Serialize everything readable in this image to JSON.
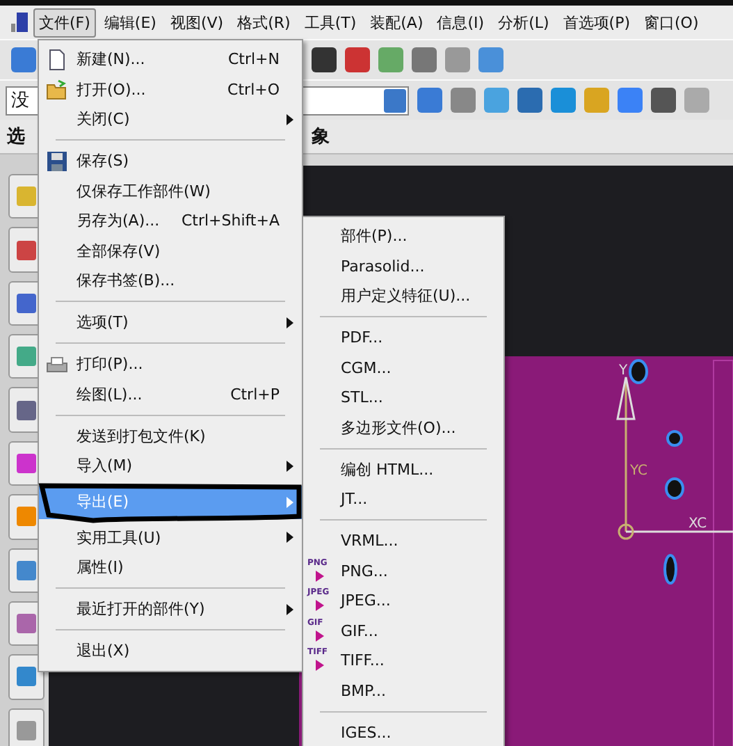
{
  "menubar": [
    {
      "label": "文件(F)",
      "selected": true
    },
    {
      "label": "编辑(E)",
      "selected": false
    },
    {
      "label": "视图(V)",
      "selected": false
    },
    {
      "label": "格式(R)",
      "selected": false
    },
    {
      "label": "工具(T)",
      "selected": false
    },
    {
      "label": "装配(A)",
      "selected": false
    },
    {
      "label": "信息(I)",
      "selected": false
    },
    {
      "label": "分析(L)",
      "selected": false
    },
    {
      "label": "首选项(P)",
      "selected": false
    },
    {
      "label": "窗口(O)",
      "selected": false
    }
  ],
  "filter_combo": {
    "value": "没"
  },
  "selection_bar": {
    "label": "选",
    "hint": "象"
  },
  "file_menu": [
    {
      "kind": "item",
      "label": "新建(N)...",
      "shortcut": "Ctrl+N",
      "submenu": false,
      "selected": false
    },
    {
      "kind": "item",
      "label": "打开(O)...",
      "shortcut": "Ctrl+O",
      "submenu": false,
      "selected": false
    },
    {
      "kind": "item",
      "label": "关闭(C)",
      "submenu": true,
      "selected": false
    },
    {
      "kind": "separator"
    },
    {
      "kind": "item",
      "label": "保存(S)",
      "submenu": false,
      "selected": false
    },
    {
      "kind": "item",
      "label": "仅保存工作部件(W)",
      "submenu": false,
      "selected": false
    },
    {
      "kind": "item",
      "label": "另存为(A)...",
      "shortcut": "Ctrl+Shift+A",
      "submenu": false,
      "selected": false
    },
    {
      "kind": "item",
      "label": "全部保存(V)",
      "submenu": false,
      "selected": false
    },
    {
      "kind": "item",
      "label": "保存书签(B)...",
      "submenu": false,
      "selected": false
    },
    {
      "kind": "separator"
    },
    {
      "kind": "item",
      "label": "选项(T)",
      "submenu": true,
      "selected": false
    },
    {
      "kind": "separator"
    },
    {
      "kind": "item",
      "label": "打印(P)...",
      "submenu": false,
      "selected": false
    },
    {
      "kind": "item",
      "label": "绘图(L)...",
      "shortcut": "Ctrl+P",
      "submenu": false,
      "selected": false
    },
    {
      "kind": "separator"
    },
    {
      "kind": "item",
      "label": "发送到打包文件(K)",
      "submenu": false,
      "selected": false
    },
    {
      "kind": "item",
      "label": "导入(M)",
      "submenu": true,
      "selected": false
    },
    {
      "kind": "item",
      "label": "导出(E)",
      "submenu": true,
      "selected": true
    },
    {
      "kind": "item",
      "label": "实用工具(U)",
      "submenu": true,
      "selected": false
    },
    {
      "kind": "item",
      "label": "属性(I)",
      "submenu": false,
      "selected": false
    },
    {
      "kind": "separator"
    },
    {
      "kind": "item",
      "label": "最近打开的部件(Y)",
      "submenu": true,
      "selected": false
    },
    {
      "kind": "separator"
    },
    {
      "kind": "item",
      "label": "退出(X)",
      "submenu": false,
      "selected": false
    }
  ],
  "export_menu": [
    {
      "kind": "item",
      "label": "部件(P)..."
    },
    {
      "kind": "item",
      "label": "Parasolid..."
    },
    {
      "kind": "item",
      "label": "用户定义特征(U)..."
    },
    {
      "kind": "separator"
    },
    {
      "kind": "item",
      "label": "PDF..."
    },
    {
      "kind": "item",
      "label": "CGM..."
    },
    {
      "kind": "item",
      "label": "STL..."
    },
    {
      "kind": "item",
      "label": "多边形文件(O)..."
    },
    {
      "kind": "separator"
    },
    {
      "kind": "item",
      "label": "编创 HTML..."
    },
    {
      "kind": "item",
      "label": "JT..."
    },
    {
      "kind": "separator"
    },
    {
      "kind": "item",
      "label": "VRML..."
    },
    {
      "kind": "item",
      "label": "PNG...",
      "badge": "PNG"
    },
    {
      "kind": "item",
      "label": "JPEG...",
      "badge": "JPEG"
    },
    {
      "kind": "item",
      "label": "GIF...",
      "badge": "GIF"
    },
    {
      "kind": "item",
      "label": "TIFF...",
      "badge": "TIFF"
    },
    {
      "kind": "item",
      "label": "BMP..."
    },
    {
      "kind": "separator"
    },
    {
      "kind": "item",
      "label": "IGES..."
    }
  ],
  "canvas": {
    "axis_labels": [
      "Y",
      "YC",
      "XC"
    ]
  }
}
